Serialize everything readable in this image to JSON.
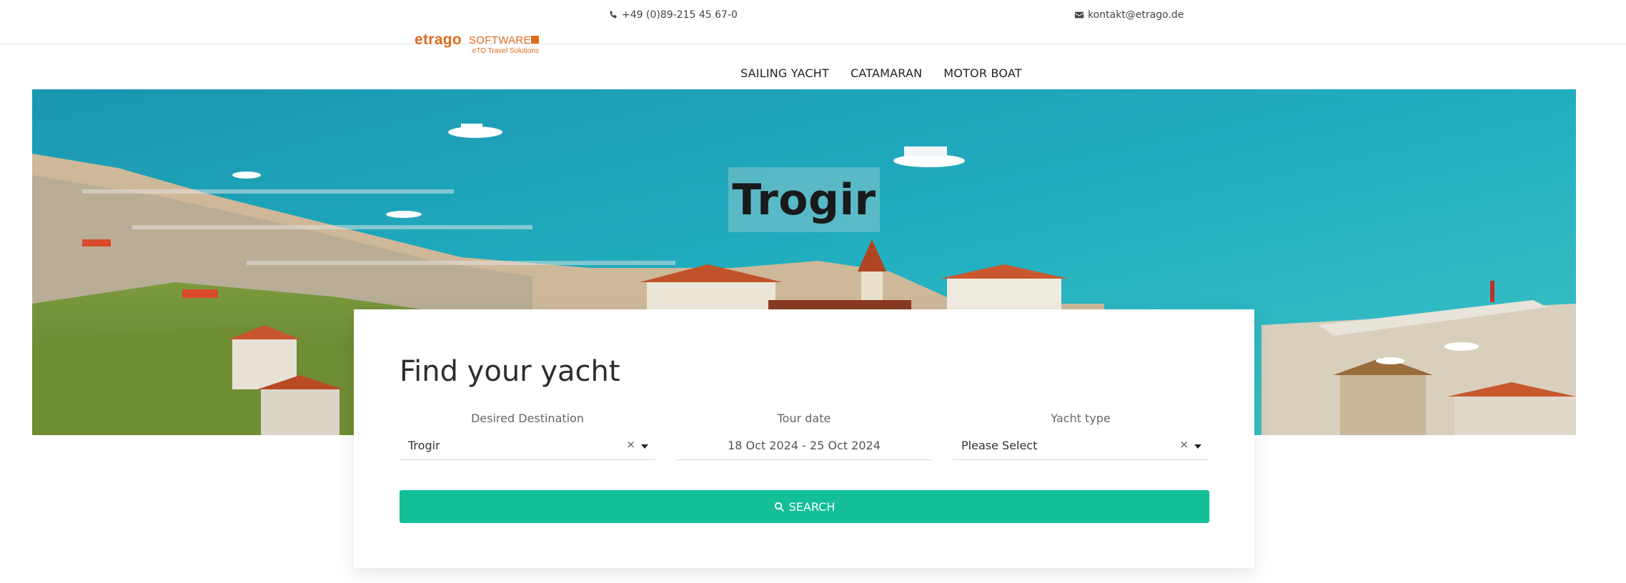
{
  "header": {
    "phone": "+49 (0)89-215 45 67-0",
    "email": "kontakt@etrago.de",
    "logo": {
      "brand": "etrago",
      "brand_suffix": "SOFTWARE",
      "tagline": "eTO Travel Solutions",
      "color": "#e26a1d"
    },
    "nav": [
      {
        "label": "SAILING YACHT"
      },
      {
        "label": "CATAMARAN"
      },
      {
        "label": "MOTOR BOAT"
      }
    ],
    "icons": {
      "phone": "phone-icon",
      "email": "envelope-icon"
    }
  },
  "hero": {
    "title": "Trogir"
  },
  "search": {
    "title": "Find your yacht",
    "destination": {
      "label": "Desired Destination",
      "value": "Trogir",
      "clear": "×"
    },
    "tour_date": {
      "label": "Tour date",
      "value": "18 Oct 2024 - 25 Oct 2024"
    },
    "yacht_type": {
      "label": "Yacht type",
      "value": "Please Select",
      "clear": "×"
    },
    "button_label": "SEARCH",
    "button_icon": "search-icon",
    "button_color": "#13bf97"
  }
}
